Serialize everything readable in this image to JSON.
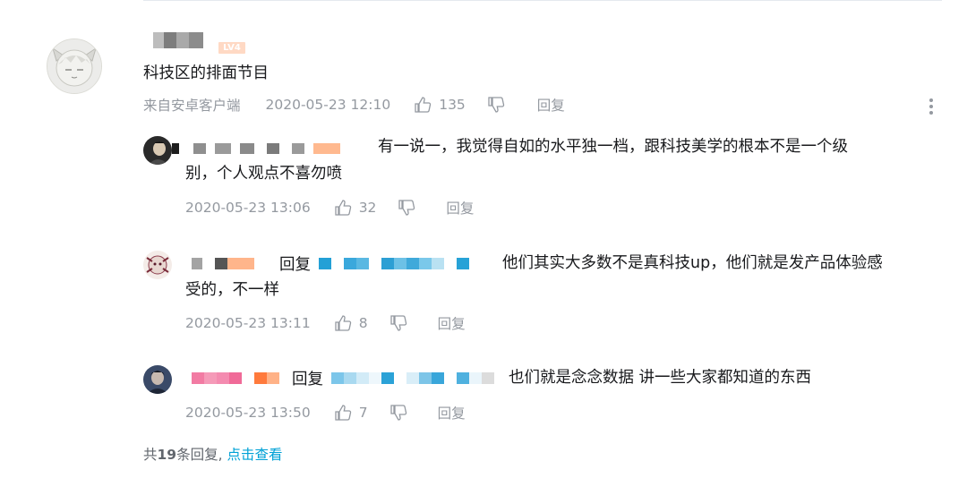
{
  "main_comment": {
    "level_badge": "LV4",
    "text": "科技区的排面节目",
    "source": "来自安卓客户端",
    "time": "2020-05-23 12:10",
    "likes": "135",
    "reply_label": "回复"
  },
  "replies": [
    {
      "text_line1": "有一说一，我觉得自如的水平独一档，跟科技美学的根本不是一个级",
      "text_line2": "别，个人观点不喜勿喷",
      "time": "2020-05-23 13:06",
      "likes": "32",
      "reply_label": "回复"
    },
    {
      "reply_prefix": "回复",
      "text_line1": "他们其实大多数不是真科技up，他们就是发产品体验感",
      "text_line2": "受的，不一样",
      "time": "2020-05-23 13:11",
      "likes": "8",
      "reply_label": "回复"
    },
    {
      "reply_prefix": "回复",
      "text_line1": "也们就是念念数据 讲一些大家都知道的东西",
      "time": "2020-05-23 13:50",
      "likes": "7",
      "reply_label": "回复"
    }
  ],
  "footer": {
    "prefix": "共",
    "count": "19",
    "suffix": "条回复,",
    "link": "点击查看"
  },
  "icons": {
    "like": "thumbs-up-icon",
    "dislike": "thumbs-down-icon",
    "more": "more-vertical-icon"
  },
  "colors": {
    "meta_gray": "#9499a0",
    "link_blue": "#00a1d6",
    "text_dark": "#18191c"
  }
}
